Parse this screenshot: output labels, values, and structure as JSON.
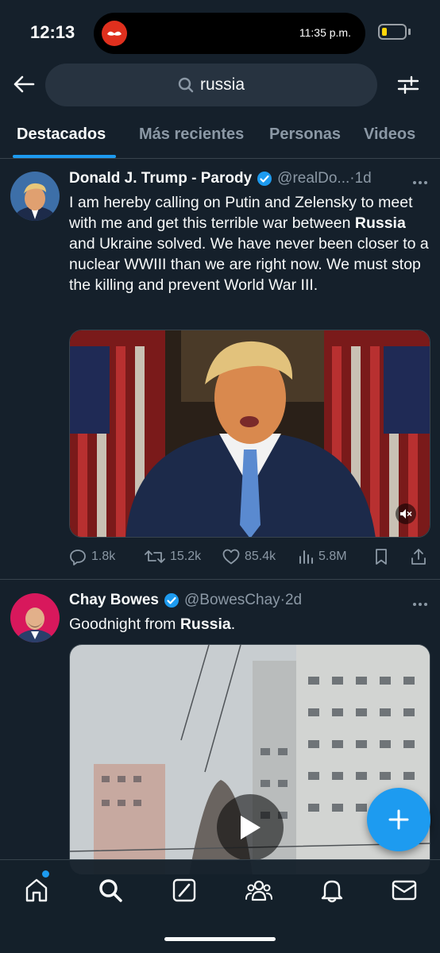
{
  "status_bar": {
    "time": "12:13",
    "island_time": "11:35 p.m.",
    "battery_level": 0.2
  },
  "search": {
    "query": "russia",
    "icon": "search-icon"
  },
  "tabs": [
    {
      "label": "Destacados",
      "active": true
    },
    {
      "label": "Más recientes",
      "active": false
    },
    {
      "label": "Personas",
      "active": false
    },
    {
      "label": "Videos",
      "active": false
    }
  ],
  "tweets": [
    {
      "author": "Donald J. Trump - Parody",
      "handle": "@realDo...",
      "time": "·1d",
      "text_parts": [
        "I am hereby calling on Putin and Zelensky to meet with me and get this terrible war between ",
        "Russia",
        " and Ukraine solved. We have never been closer to a nuclear WWIII than we are right now. We must stop the killing and prevent World War III."
      ],
      "stats": {
        "replies": "1.8k",
        "retweets": "15.2k",
        "likes": "85.4k",
        "views": "5.8M"
      }
    },
    {
      "author": "Chay Bowes",
      "handle": "@BowesChay",
      "time": "·2d",
      "text_parts": [
        "Goodnight from ",
        "Russia",
        "."
      ]
    }
  ],
  "colors": {
    "background": "#15202b",
    "accent": "#1d9bf0",
    "secondary_text": "#8b98a5",
    "divider": "#38444d"
  },
  "nav": [
    {
      "icon": "home-icon"
    },
    {
      "icon": "search-icon"
    },
    {
      "icon": "grok-icon"
    },
    {
      "icon": "communities-icon"
    },
    {
      "icon": "notifications-icon"
    },
    {
      "icon": "messages-icon"
    }
  ]
}
